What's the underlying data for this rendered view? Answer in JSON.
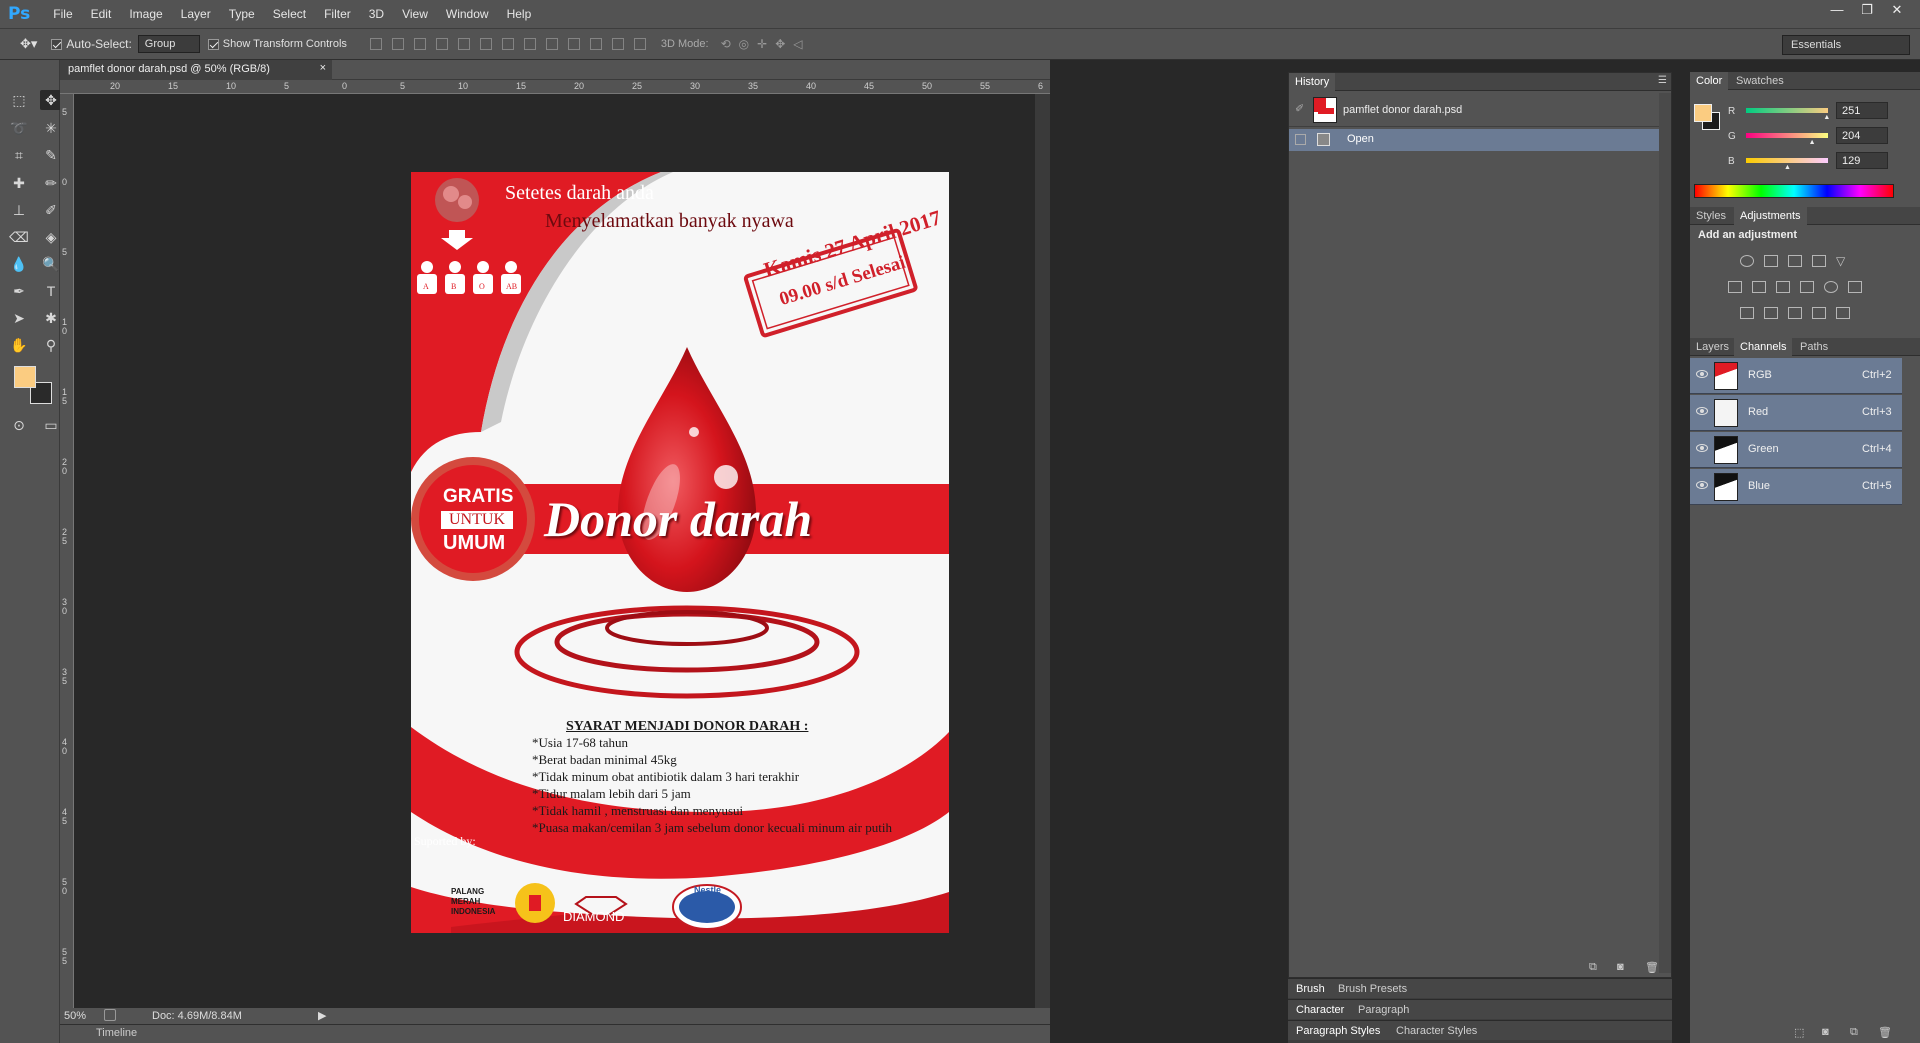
{
  "menubar": {
    "logo": "Ps",
    "items": [
      "File",
      "Edit",
      "Image",
      "Layer",
      "Type",
      "Select",
      "Filter",
      "3D",
      "View",
      "Window",
      "Help"
    ],
    "window_controls": [
      "—",
      "❐",
      "✕"
    ]
  },
  "options": {
    "auto_select_label": "Auto-Select:",
    "auto_select_value": "Group",
    "show_transform_label": "Show Transform Controls",
    "mode_label": "3D Mode:",
    "workspace": "Essentials"
  },
  "document": {
    "tab_title": "pamflet donor darah.psd @ 50% (RGB/8)",
    "tab_close": "×",
    "zoom": "50%",
    "doc_size": "Doc: 4.69M/8.84M",
    "timeline_label": "Timeline",
    "hruler_labels": [
      "20",
      "15",
      "10",
      "5",
      "0",
      "5",
      "10",
      "15",
      "20",
      "25",
      "30",
      "35",
      "40",
      "45",
      "50",
      "55",
      "6"
    ],
    "vruler_labels": [
      "5",
      "0",
      "5",
      "1 0",
      "1 5",
      "2 0",
      "2 5",
      "3 0",
      "3 5",
      "4 0",
      "4 5",
      "5 0",
      "5 5"
    ]
  },
  "poster": {
    "slogan_line1": "Setetes darah anda",
    "slogan_line2": "Menyelamatkan banyak nyawa",
    "blood_types": [
      "A",
      "B",
      "O",
      "AB"
    ],
    "stamp_line1": "Kamis 27 April 2017",
    "stamp_line2": "09.00 s/d Selesai",
    "badge_line1": "GRATIS",
    "badge_line2": "UNTUK",
    "badge_line3": "UMUM",
    "headline": "Donor darah",
    "requirements_title": "SYARAT MENJADI DONOR DARAH :",
    "requirements": [
      "*Usia 17-68 tahun",
      "*Berat badan minimal 45kg",
      "*Tidak minum obat antibiotik dalam 3 hari terakhir",
      "*Tidur malam lebih dari 5 jam",
      "*Tidak hamil , menstruasi dan menyusui",
      "*Puasa makan/cemilan 3 jam sebelum donor kecuali minum air putih"
    ],
    "supported_by": "Suported by:",
    "sponsor_pmi": [
      "PALANG",
      "MERAH",
      "INDONESIA"
    ],
    "sponsor_diamond": "DIAMOND",
    "sponsor_nestle": "Nestle",
    "colors": {
      "red": "#e01b24",
      "dark_red": "#9e0d14",
      "paper": "#f7f7f7"
    }
  },
  "history": {
    "tab_label": "History",
    "snapshot_name": "pamflet donor darah.psd",
    "items": [
      "Open"
    ]
  },
  "color_panel": {
    "tabs": [
      "Color",
      "Swatches"
    ],
    "foreground": "#fbcc81",
    "channels": [
      {
        "label": "R",
        "value": "251",
        "fraction": 0.98
      },
      {
        "label": "G",
        "value": "204",
        "fraction": 0.8
      },
      {
        "label": "B",
        "value": "129",
        "fraction": 0.5
      }
    ]
  },
  "adjustments": {
    "tabs": [
      "Styles",
      "Adjustments"
    ],
    "heading": "Add an adjustment"
  },
  "channels_panel": {
    "tabs": [
      "Layers",
      "Channels",
      "Paths"
    ],
    "rows": [
      {
        "name": "RGB",
        "shortcut": "Ctrl+2"
      },
      {
        "name": "Red",
        "shortcut": "Ctrl+3"
      },
      {
        "name": "Green",
        "shortcut": "Ctrl+4"
      },
      {
        "name": "Blue",
        "shortcut": "Ctrl+5"
      }
    ]
  },
  "bottom_tabs": {
    "row1": [
      "Brush",
      "Brush Presets"
    ],
    "row2": [
      "Character",
      "Paragraph"
    ],
    "row3": [
      "Paragraph Styles",
      "Character Styles"
    ]
  }
}
